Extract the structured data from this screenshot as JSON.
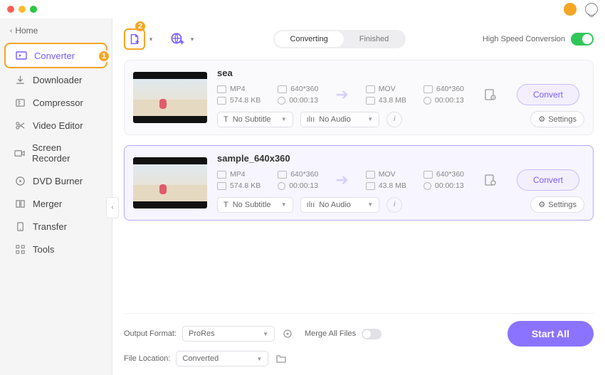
{
  "nav": {
    "back": "Home",
    "items": [
      {
        "label": "Converter"
      },
      {
        "label": "Downloader"
      },
      {
        "label": "Compressor"
      },
      {
        "label": "Video Editor"
      },
      {
        "label": "Screen Recorder"
      },
      {
        "label": "DVD Burner"
      },
      {
        "label": "Merger"
      },
      {
        "label": "Transfer"
      },
      {
        "label": "Tools"
      }
    ]
  },
  "callouts": {
    "one": "1",
    "two": "2"
  },
  "tabs": {
    "left": "Converting",
    "right": "Finished"
  },
  "highspeed": {
    "label": "High Speed Conversion"
  },
  "items": [
    {
      "name": "sea",
      "src": {
        "format": "MP4",
        "res": "640*360",
        "size": "574.8 KB",
        "dur": "00:00:13"
      },
      "dst": {
        "format": "MOV",
        "res": "640*360",
        "size": "43.8 MB",
        "dur": "00:00:13"
      },
      "subtitle": "No Subtitle",
      "audio": "No Audio",
      "settings": "Settings",
      "convert": "Convert"
    },
    {
      "name": "sample_640x360",
      "src": {
        "format": "MP4",
        "res": "640*360",
        "size": "574.8 KB",
        "dur": "00:00:13"
      },
      "dst": {
        "format": "MOV",
        "res": "640*360",
        "size": "43.8 MB",
        "dur": "00:00:13"
      },
      "subtitle": "No Subtitle",
      "audio": "No Audio",
      "settings": "Settings",
      "convert": "Convert"
    }
  ],
  "footer": {
    "outfmt_label": "Output Format:",
    "outfmt": "ProRes",
    "loc_label": "File Location:",
    "loc": "Converted",
    "merge": "Merge All Files",
    "start": "Start All"
  }
}
